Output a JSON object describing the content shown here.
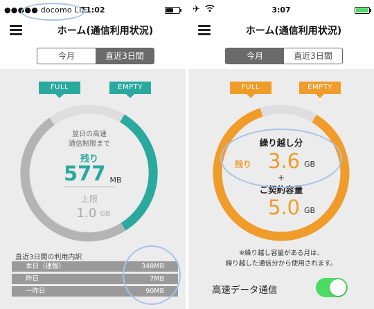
{
  "left": {
    "status": {
      "carrier": "●●●●● docomo  LTE",
      "time": "11:02"
    },
    "nav": {
      "title": "ホーム(通信利用状況)"
    },
    "tabs": [
      {
        "label": "今月",
        "active": false
      },
      {
        "label": "直近3日間",
        "active": true
      }
    ],
    "gauge": {
      "full_label": "FULL",
      "empty_label": "EMPTY",
      "caption_line1": "翌日の高速",
      "caption_line2": "通信制限まで",
      "remaining_label": "残り",
      "remaining_value": "577",
      "remaining_unit": "MB",
      "limit_label": "上限",
      "limit_value": "1.0",
      "limit_unit": "GB",
      "accent_color": "#2aa99f",
      "track_color": "#b4b4b4"
    },
    "breakdown": {
      "title": "直近3日間の利用内訳",
      "rows": [
        {
          "label": "本日（速報）",
          "value": "348MB"
        },
        {
          "label": "昨日",
          "value": "7MB"
        },
        {
          "label": "一昨日",
          "value": "90MB"
        }
      ]
    }
  },
  "right": {
    "status": {
      "time": "3:07",
      "plane_icon": "airplane-icon",
      "wifi_icon": "wifi-icon"
    },
    "nav": {
      "title": "ホーム(通信利用状況)"
    },
    "tabs": [
      {
        "label": "今月",
        "active": true
      },
      {
        "label": "直近3日間",
        "active": false
      }
    ],
    "gauge": {
      "full_label": "FULL",
      "empty_label": "EMPTY",
      "carryover_label": "繰り越し分",
      "remaining_label": "残り",
      "carryover_value": "3.6",
      "carryover_unit": "GB",
      "plus": "+",
      "contract_label": "ご契約容量",
      "contract_value": "5.0",
      "contract_unit": "GB",
      "accent_color": "#ef9c2a"
    },
    "note_line1": "※繰り越し容量がある月は、",
    "note_line2": "繰り越した通信分から使用されます。",
    "toggle": {
      "label": "高速データ通信",
      "on": true
    }
  }
}
